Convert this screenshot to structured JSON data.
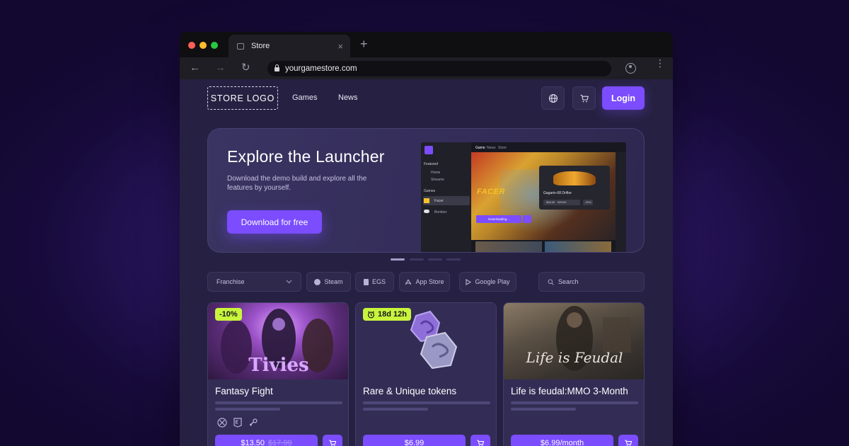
{
  "browser": {
    "tab_title": "Store",
    "new_tab_symbol": "+",
    "close_symbol": "×",
    "url": "yourgamestore.com",
    "back_symbol": "←",
    "forward_symbol": "→",
    "reload_symbol": "↻",
    "menu_symbol": "⋮"
  },
  "header": {
    "logo": "STORE LOGO",
    "nav": [
      "Games",
      "News"
    ],
    "login": "Login"
  },
  "hero": {
    "title": "Explore the Launcher",
    "description": "Download the demo build and explore all the features by yourself.",
    "button": "Download for free",
    "launcher": {
      "tabs": [
        "Game",
        "News",
        "Store"
      ],
      "featured_label": "Featured",
      "menu": [
        "Home",
        "Streams"
      ],
      "games_label": "Games",
      "games": [
        "Facer",
        "Bomber"
      ],
      "game_logo": "FACER",
      "card_title": "Gagarin-68 Drifter",
      "card_price": "$38.00",
      "card_old_price": "$49.00",
      "card_discount": "-20%",
      "download_label": "Downloading..."
    },
    "slides": 4,
    "active_slide": 0
  },
  "filters": {
    "franchise": "Franchise",
    "platforms": [
      "Steam",
      "EGS",
      "App Store",
      "Google Play"
    ],
    "search_placeholder": "Search"
  },
  "products": [
    {
      "title": "Fantasy Fight",
      "badge": "-10%",
      "price": "$13.50",
      "old_price": "$17.99",
      "platforms": [
        "xbox-icon",
        "epic-games-icon",
        "steam-icon"
      ],
      "art_text": "Tivies"
    },
    {
      "title": "Rare & Unique tokens",
      "badge": "18d 12h",
      "price": "$6.99"
    },
    {
      "title": "Life is feudal:MMO 3-Month",
      "price": "$6.99/month",
      "art_text": "Life is Feudal"
    }
  ],
  "colors": {
    "accent": "#7b4dff",
    "badge": "#c8f53c",
    "page_bg": "#262142"
  }
}
